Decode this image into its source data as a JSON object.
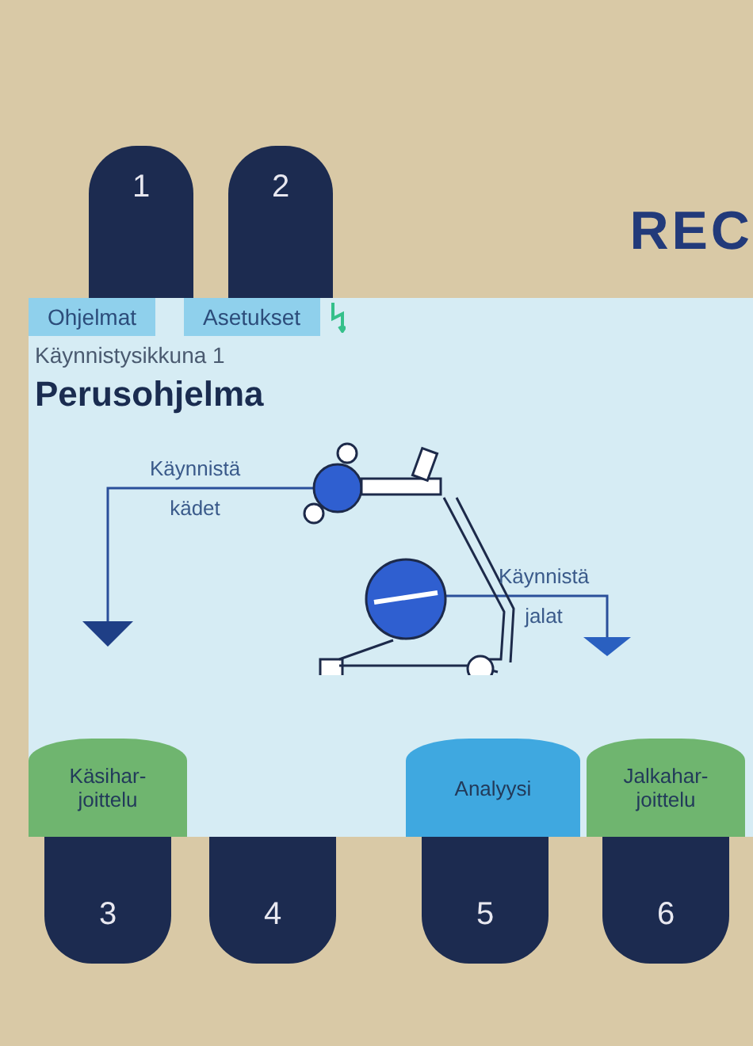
{
  "top_keys": [
    {
      "label": "1"
    },
    {
      "label": "2"
    }
  ],
  "brand": "REC",
  "tabs": [
    {
      "label": "Ohjelmat"
    },
    {
      "label": "Asetukset"
    }
  ],
  "subtitle": "Käynnistysikkuna 1",
  "title": "Perusohjelma",
  "diagram": {
    "left_label": "Käynnistä kädet",
    "right_label": "Käynnistä jalat"
  },
  "bottom_keys": [
    {
      "label": "3",
      "softkey": {
        "label": "Käsihar-joittelu",
        "color": "#6fb56f"
      }
    },
    {
      "label": "4"
    },
    {
      "label": "5",
      "softkey": {
        "label": "Analyysi",
        "color": "#3fa8e0"
      }
    },
    {
      "label": "6",
      "softkey": {
        "label": "Jalkahar-joittelu",
        "color": "#6fb56f"
      }
    }
  ]
}
